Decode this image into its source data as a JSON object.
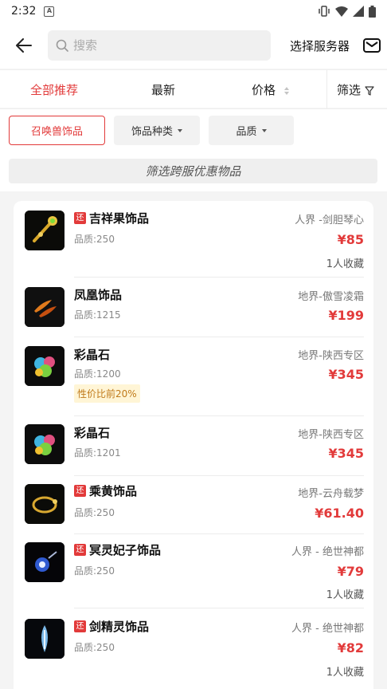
{
  "status": {
    "time": "2:32",
    "notif_letter": "A"
  },
  "header": {
    "search_placeholder": "搜索",
    "server_label": "选择服务器"
  },
  "sort_tabs": {
    "all": "全部推荐",
    "latest": "最新",
    "price": "价格",
    "filter": "筛选"
  },
  "chips": {
    "category": "召唤兽饰品",
    "type": "饰品种类",
    "quality": "品质"
  },
  "promo": "筛选跨服优惠物品",
  "colors": {
    "accent": "#e23a3a",
    "discount_bg": "#fff5d6",
    "discount_text": "#c07a1a"
  },
  "items": [
    {
      "tag": "还",
      "name": "吉祥果饰品",
      "quality": "品质:250",
      "server": "人界 -剑胆琴心",
      "price": "¥85",
      "fav": "1人收藏",
      "icon": "gold-scepter-icon"
    },
    {
      "tag": "",
      "name": "凤凰饰品",
      "quality": "品质:1215",
      "server": "地界-傲雪凌霜",
      "price": "¥199",
      "fav": "",
      "icon": "phoenix-feather-icon"
    },
    {
      "tag": "",
      "name": "彩晶石",
      "quality": "品质:1200",
      "server": "地界-陕西专区",
      "price": "¥345",
      "fav": "",
      "discount": "性价比前20%",
      "icon": "crystal-stone-icon"
    },
    {
      "tag": "",
      "name": "彩晶石",
      "quality": "品质:1201",
      "server": "地界-陕西专区",
      "price": "¥345",
      "fav": "",
      "icon": "crystal-stone-icon"
    },
    {
      "tag": "还",
      "name": "乘黄饰品",
      "quality": "品质:250",
      "server": "地界-云舟载梦",
      "price": "¥61.40",
      "fav": "",
      "icon": "gold-ring-icon"
    },
    {
      "tag": "还",
      "name": "冥灵妃子饰品",
      "quality": "品质:250",
      "server": "人界 - 绝世神都",
      "price": "¥79",
      "fav": "1人收藏",
      "icon": "spirit-orb-icon"
    },
    {
      "tag": "还",
      "name": "剑精灵饰品",
      "quality": "品质:250",
      "server": "人界 - 绝世神都",
      "price": "¥82",
      "fav": "1人收藏",
      "icon": "sword-spirit-icon"
    }
  ]
}
